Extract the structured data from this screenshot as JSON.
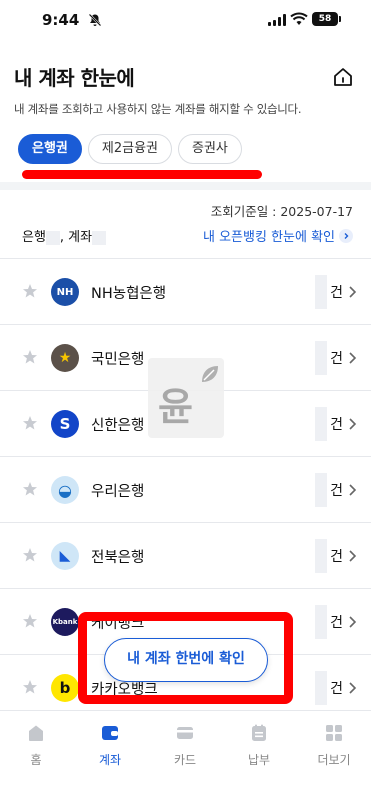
{
  "status_bar": {
    "time": "9:44",
    "battery": "58"
  },
  "header": {
    "title": "내 계좌 한눈에",
    "description": "내 계좌를 조회하고 사용하지 않는 계좌를 해지할 수 있습니다."
  },
  "tabs": [
    {
      "label": "은행권",
      "active": true
    },
    {
      "label": "제2금융권",
      "active": false
    },
    {
      "label": "증권사",
      "active": false
    }
  ],
  "summary": {
    "inquiry_date": "조회기준일 : 2025-07-17",
    "count_label_bank": "은행",
    "count_label_account": ", 계좌",
    "openbanking_link": "내 오픈뱅킹 한눈에 확인"
  },
  "banks": [
    {
      "name": "NH농협은행",
      "unit": "건",
      "logo": "NH",
      "logo_bg": "#1b4fa8",
      "logo_color": "#ffffff"
    },
    {
      "name": "국민은행",
      "unit": "건",
      "logo": "★",
      "logo_bg": "#5b5149",
      "logo_color": "#f5c400"
    },
    {
      "name": "신한은행",
      "unit": "건",
      "logo": "S",
      "logo_bg": "#1245c8",
      "logo_color": "#ffffff"
    },
    {
      "name": "우리은행",
      "unit": "건",
      "logo": "◒",
      "logo_bg": "#cfe6f7",
      "logo_color": "#1a6fc4"
    },
    {
      "name": "전북은행",
      "unit": "건",
      "logo": "◣",
      "logo_bg": "#cfe6f7",
      "logo_color": "#1a5cd6"
    },
    {
      "name": "케이뱅크",
      "unit": "건",
      "logo": "Kbank",
      "logo_bg": "#1d1a5e",
      "logo_color": "#ffffff"
    },
    {
      "name": "카카오뱅크",
      "unit": "건",
      "logo": "b",
      "logo_bg": "#ffe600",
      "logo_color": "#111111"
    }
  ],
  "watermark": {
    "text": "윤"
  },
  "cta": {
    "label": "내 계좌 한번에 확인"
  },
  "tabbar": [
    {
      "label": "홈",
      "icon": "home-icon",
      "active": false
    },
    {
      "label": "계좌",
      "icon": "wallet-icon",
      "active": true
    },
    {
      "label": "카드",
      "icon": "card-icon",
      "active": false
    },
    {
      "label": "납부",
      "icon": "bill-icon",
      "active": false
    },
    {
      "label": "더보기",
      "icon": "grid-icon",
      "active": false
    }
  ],
  "colors": {
    "accent": "#1a5cd6",
    "highlight": "#ff0000"
  }
}
